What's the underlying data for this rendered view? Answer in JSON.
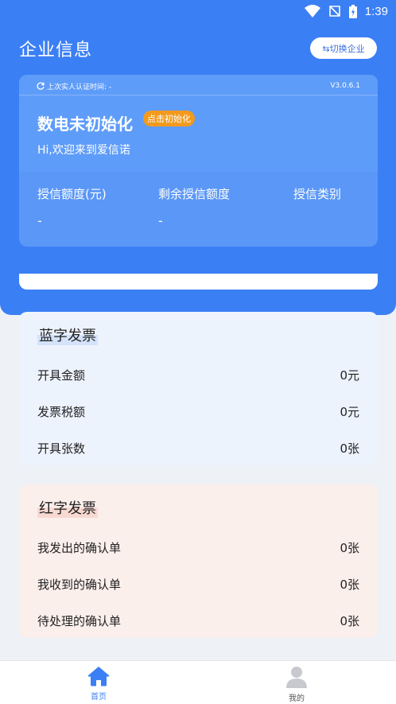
{
  "status_bar": {
    "time": "1:39"
  },
  "header": {
    "title": "企业信息",
    "switch_button": "⇆切换企业"
  },
  "info_card": {
    "last_verify": "上次实人认证时间: -",
    "version": "V3.0.6.1",
    "company_name": "数电未初始化",
    "init_badge": "点击初始化",
    "welcome": "Hi,欢迎来到爱信诺",
    "credit": [
      {
        "label": "授信额度(元)",
        "value": "-"
      },
      {
        "label": "剩余授信额度",
        "value": "-"
      },
      {
        "label": "授信类别",
        "value": ""
      }
    ]
  },
  "blue_invoice": {
    "title": "蓝字发票",
    "rows": [
      {
        "label": "开具金额",
        "value": "0元"
      },
      {
        "label": "发票税额",
        "value": "0元"
      },
      {
        "label": "开具张数",
        "value": "0张"
      }
    ]
  },
  "red_invoice": {
    "title": "红字发票",
    "rows": [
      {
        "label": "我发出的确认单",
        "value": "0张"
      },
      {
        "label": "我收到的确认单",
        "value": "0张"
      },
      {
        "label": "待处理的确认单",
        "value": "0张"
      }
    ]
  },
  "bottom_nav": {
    "items": [
      {
        "label": "首页",
        "icon": "home-icon",
        "active": true
      },
      {
        "label": "我的",
        "icon": "user-icon",
        "active": false
      }
    ]
  },
  "colors": {
    "primary": "#3b7ff5",
    "badge": "#f29a1d",
    "blue_panel": "#edf3fd",
    "red_panel": "#fbefec"
  }
}
